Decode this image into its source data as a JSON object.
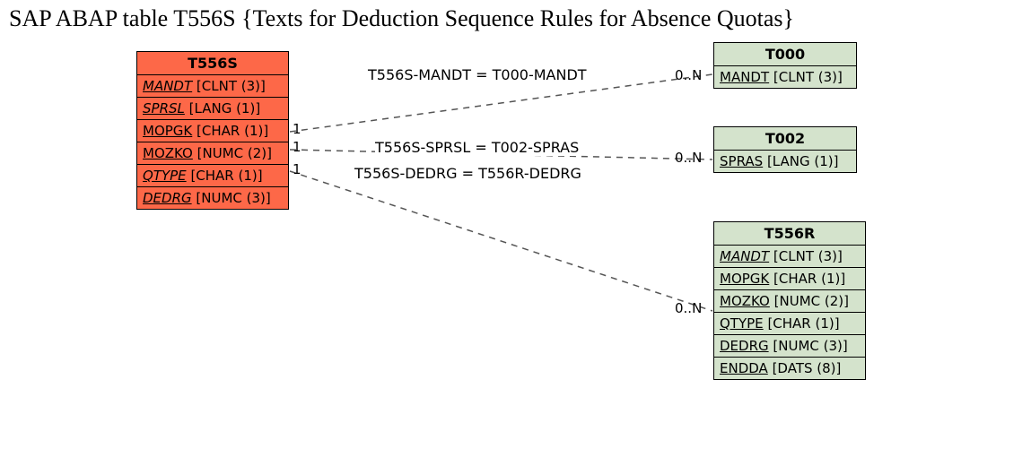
{
  "title": "SAP ABAP table T556S {Texts for Deduction Sequence Rules for Absence Quotas}",
  "entities": {
    "t556s": {
      "name": "T556S",
      "fields": [
        {
          "name": "MANDT",
          "type": "[CLNT (3)]",
          "key": true
        },
        {
          "name": "SPRSL",
          "type": "[LANG (1)]",
          "key": true
        },
        {
          "name": "MOPGK",
          "type": "[CHAR (1)]",
          "key": false
        },
        {
          "name": "MOZKO",
          "type": "[NUMC (2)]",
          "key": false
        },
        {
          "name": "QTYPE",
          "type": "[CHAR (1)]",
          "key": true
        },
        {
          "name": "DEDRG",
          "type": "[NUMC (3)]",
          "key": true
        }
      ]
    },
    "t000": {
      "name": "T000",
      "fields": [
        {
          "name": "MANDT",
          "type": "[CLNT (3)]",
          "key": false
        }
      ]
    },
    "t002": {
      "name": "T002",
      "fields": [
        {
          "name": "SPRAS",
          "type": "[LANG (1)]",
          "key": false
        }
      ]
    },
    "t556r": {
      "name": "T556R",
      "fields": [
        {
          "name": "MANDT",
          "type": "[CLNT (3)]",
          "key": true
        },
        {
          "name": "MOPGK",
          "type": "[CHAR (1)]",
          "key": false
        },
        {
          "name": "MOZKO",
          "type": "[NUMC (2)]",
          "key": false
        },
        {
          "name": "QTYPE",
          "type": "[CHAR (1)]",
          "key": false
        },
        {
          "name": "DEDRG",
          "type": "[NUMC (3)]",
          "key": false
        },
        {
          "name": "ENDDA",
          "type": "[DATS (8)]",
          "key": false
        }
      ]
    }
  },
  "relations": {
    "r1": {
      "label": "T556S-MANDT = T000-MANDT",
      "left_card": "1",
      "right_card": "0..N"
    },
    "r2": {
      "label": "T556S-SPRSL = T002-SPRAS",
      "left_card": "1",
      "right_card": "0..N"
    },
    "r3": {
      "label": "T556S-DEDRG = T556R-DEDRG",
      "left_card": "1",
      "right_card": "0..N"
    }
  }
}
